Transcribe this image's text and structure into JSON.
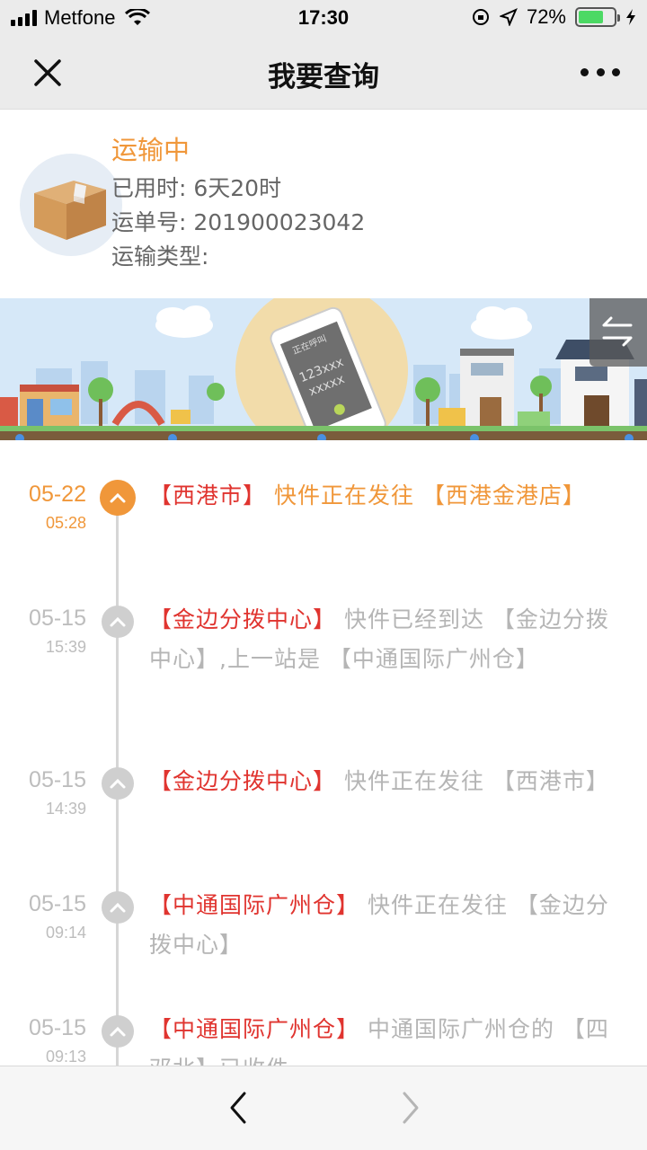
{
  "status_bar": {
    "carrier": "Metfone",
    "time": "17:30",
    "battery": "72%",
    "battery_level": 0.72
  },
  "nav": {
    "title": "我要查询"
  },
  "shipment": {
    "status": "运输中",
    "elapsed": "已用时: 6天20时",
    "tracking_no": "运单号: 201900023042",
    "transport_type": "运输类型:"
  },
  "banner": {
    "phone_text_1": "正在呼叫",
    "phone_text_2": "123xxx",
    "phone_text_3": "xxxxx"
  },
  "timeline": [
    {
      "date": "05-22",
      "time": "05:28",
      "active": true,
      "location": "【西港市】",
      "message": " 快件正在发往 【西港金港店】"
    },
    {
      "date": "05-15",
      "time": "15:39",
      "active": false,
      "location": "【金边分拨中心】",
      "message": " 快件已经到达 【金边分拨中心】,上一站是 【中通国际广州仓】"
    },
    {
      "date": "05-15",
      "time": "14:39",
      "active": false,
      "location": "【金边分拨中心】",
      "message": " 快件正在发往 【西港市】"
    },
    {
      "date": "05-15",
      "time": "09:14",
      "active": false,
      "location": "【中通国际广州仓】",
      "message": " 快件正在发往 【金边分拨中心】"
    },
    {
      "date": "05-15",
      "time": "09:13",
      "active": false,
      "location": "【中通国际广州仓】",
      "message": " 中通国际广州仓的 【四邓北】已收件"
    }
  ],
  "colors": {
    "accent": "#f0973a",
    "location_red": "#e0342f",
    "muted": "#b5b5b5"
  },
  "icons": {
    "close": "close-icon",
    "more": "more-dots-icon",
    "back": "chevron-left-icon",
    "forward": "chevron-right-icon",
    "switch": "swap-arrows-icon",
    "package": "package-box-icon"
  }
}
